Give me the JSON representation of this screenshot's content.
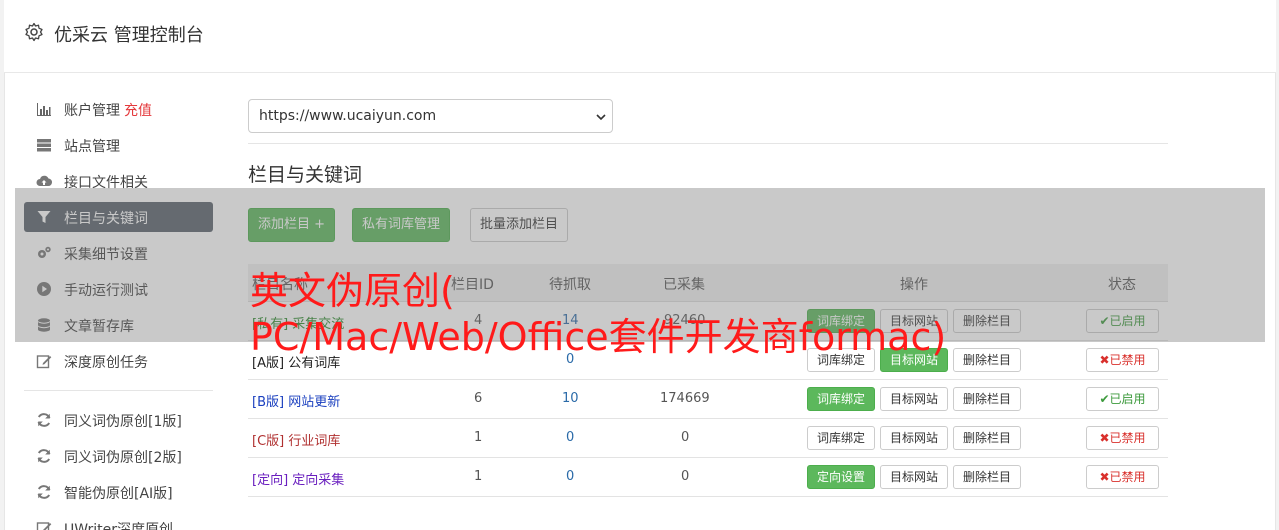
{
  "header": {
    "title": "优采云 管理控制台"
  },
  "sidebar": {
    "items": [
      {
        "label": "账户管理",
        "extra": "充值",
        "icon": "bar-chart-icon"
      },
      {
        "label": "站点管理",
        "icon": "server-icon"
      },
      {
        "label": "接口文件相关",
        "icon": "cloud-upload-icon"
      },
      {
        "label": "栏目与关键词",
        "icon": "filter-icon",
        "active": true
      },
      {
        "label": "采集细节设置",
        "icon": "gears-icon"
      },
      {
        "label": "手动运行测试",
        "icon": "play-circle-icon"
      },
      {
        "label": "文章暂存库",
        "icon": "database-icon"
      },
      {
        "label": "深度原创任务",
        "icon": "edit-icon"
      }
    ],
    "items2": [
      {
        "label": "同义词伪原创[1版]",
        "icon": "refresh-icon"
      },
      {
        "label": "同义词伪原创[2版]",
        "icon": "refresh-icon"
      },
      {
        "label": "智能伪原创[AI版]",
        "icon": "refresh-icon"
      },
      {
        "label": "UWriter深度原创",
        "icon": "edit-icon"
      }
    ]
  },
  "main": {
    "site_select": "https://www.ucaiyun.com",
    "section_title": "栏目与关键词",
    "toolbar": {
      "add": "添加栏目 +",
      "private_lib": "私有词库管理",
      "batch_add": "批量添加栏目"
    },
    "table": {
      "headers": [
        "栏目名称",
        "栏目ID",
        "待抓取",
        "已采集",
        "操作",
        "状态"
      ],
      "rows": [
        {
          "tag": "[私有]",
          "name": "采集交流",
          "id": "4",
          "pending": "14",
          "collected": "92460",
          "op1": "词库绑定",
          "op2": "目标网站",
          "op3": "删除栏目",
          "status": "已启用"
        },
        {
          "tag": "[A版]",
          "name": "公有词库",
          "id": "",
          "pending": "0",
          "collected": "",
          "op1": "词库绑定",
          "op2": "目标网站",
          "op3": "删除栏目",
          "status": "已禁用"
        },
        {
          "tag": "[B版]",
          "name": "网站更新",
          "id": "6",
          "pending": "10",
          "collected": "174669",
          "op1": "词库绑定",
          "op2": "目标网站",
          "op3": "删除栏目",
          "status": "已启用"
        },
        {
          "tag": "[C版]",
          "name": "行业词库",
          "id": "1",
          "pending": "0",
          "collected": "0",
          "op1": "词库绑定",
          "op2": "目标网站",
          "op3": "删除栏目",
          "status": "已禁用"
        },
        {
          "tag": "[定向]",
          "name": "定向采集",
          "id": "1",
          "pending": "0",
          "collected": "0",
          "op1": "定向设置",
          "op2": "目标网站",
          "op3": "删除栏目",
          "status": "已禁用"
        }
      ]
    }
  },
  "watermark": {
    "line1": "英文伪原创(",
    "line2": "PC/Mac/Web/Office套件开发商formac)"
  },
  "colors": {
    "green": "#5cb85c",
    "active_nav": "#59626c",
    "red": "#e4393c",
    "link_blue": "#1a3fbf"
  }
}
